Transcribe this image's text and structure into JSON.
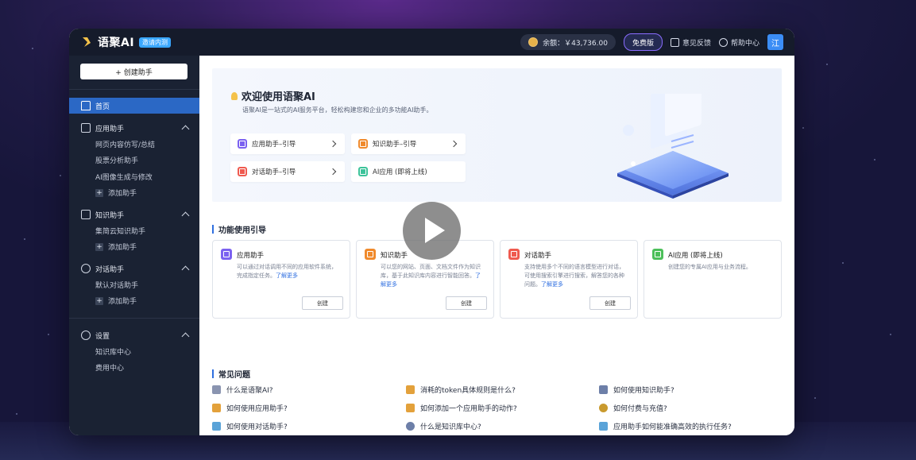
{
  "topbar": {
    "app_name": "语聚AI",
    "badge": "邀请内测",
    "balance": "余额：￥43,736.00",
    "plan_button": "免费版",
    "feedback": "意见反馈",
    "help": "帮助中心",
    "avatar": "江"
  },
  "sidebar": {
    "create_button": "+ 创建助手",
    "home": "首页",
    "groups": [
      {
        "title": "应用助手",
        "items": [
          "网页内容仿写/总结",
          "股票分析助手",
          "AI图像生成与修改"
        ],
        "add": "添加助手"
      },
      {
        "title": "知识助手",
        "items": [
          "集简云知识助手"
        ],
        "add": "添加助手"
      },
      {
        "title": "对话助手",
        "items": [
          "默认对话助手"
        ],
        "add": "添加助手"
      },
      {
        "title": "设置",
        "items": [
          "知识库中心",
          "费用中心"
        ]
      }
    ]
  },
  "hero": {
    "title": "欢迎使用语聚AI",
    "subtitle": "语聚AI是一站式的AI服务平台，轻松构建您和企业的多功能AI助手。",
    "guides": [
      {
        "label": "应用助手–引导",
        "color": "#7b61f0"
      },
      {
        "label": "知识助手–引导",
        "color": "#f08a2c"
      },
      {
        "label": "对话助手–引导",
        "color": "#ef5a4f"
      },
      {
        "label": "AI应用 (即将上线)",
        "color": "#3cc39a"
      }
    ]
  },
  "feature_section": {
    "title": "功能使用引导",
    "cards": [
      {
        "title": "应用助手",
        "desc": "可以通过对话调用不同的应用软件系统，完成指定任务。",
        "more": "了解更多",
        "button": "创建",
        "color": "#7b61f0"
      },
      {
        "title": "知识助手",
        "desc": "可以您的网站、页面、文档文件作为知识库，基于此知识库内容进行智能回答。",
        "more": "了解更多",
        "button": "创建",
        "color": "#f08a2c"
      },
      {
        "title": "对话助手",
        "desc": "支持使用多个不同的语言模型进行对话，可使用搜索引擎进行搜索，解答您的各种问题。",
        "more": "了解更多",
        "button": "创建",
        "color": "#ef5a4f"
      },
      {
        "title": "AI应用 (即将上线)",
        "desc": "创建您的专属AI应用与业务流程。",
        "color": "#4cbf5a"
      }
    ]
  },
  "faq_section": {
    "title": "常见问题",
    "items": [
      {
        "text": "什么是语聚AI?",
        "color": "#8a94b0"
      },
      {
        "text": "消耗的token具体规则是什么?",
        "color": "#e3a13b"
      },
      {
        "text": "如何使用知识助手?",
        "color": "#6d7fa8"
      },
      {
        "text": "如何使用应用助手?",
        "color": "#e3a13b"
      },
      {
        "text": "如何添加一个应用助手的动作?",
        "color": "#e3a13b"
      },
      {
        "text": "如何付费与充值?",
        "color": "#c99a2e"
      },
      {
        "text": "如何使用对话助手?",
        "color": "#5aa3d8"
      },
      {
        "text": "什么是知识库中心?",
        "color": "#6d7fa8"
      },
      {
        "text": "应用助手如何能准确高效的执行任务?",
        "color": "#5aa3d8"
      }
    ]
  }
}
